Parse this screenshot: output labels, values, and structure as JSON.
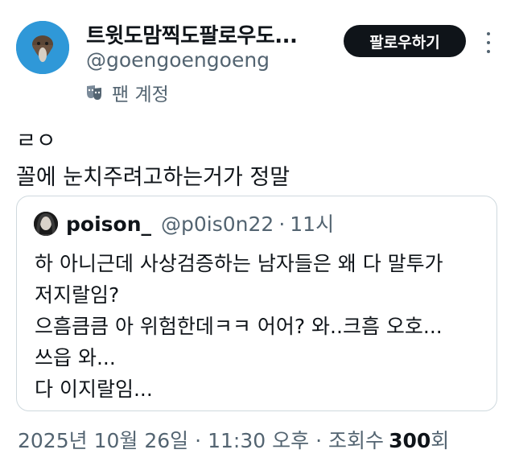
{
  "header": {
    "display_name": "트윗도맘찍도팔로우도...",
    "handle": "@goengoengoeng",
    "badge_label": "팬 계정",
    "follow_label": "팔로우하기"
  },
  "tweet": {
    "lines": [
      "ㄹㅇ",
      "꼴에 눈치주려고하는거가 정말"
    ]
  },
  "quote": {
    "name": "poison_",
    "handle": "@p0is0n22",
    "separator": "·",
    "time": "11시",
    "lines": [
      "하 아니근데 사상검증하는 남자들은 왜 다 말투가",
      "저지랄임?",
      "으흠큼큼 아 위험한데ㅋㅋ 어어? 와..크흠 오호...",
      "쓰읍 와...",
      "다 이지랄임..."
    ]
  },
  "meta": {
    "date": "2025년 10월 26일",
    "separator": "·",
    "time": "11:30 오후",
    "views_label": "조회수",
    "views_count": "300",
    "views_suffix": "회"
  },
  "colors": {
    "text": "#0f1419",
    "secondary": "#536471",
    "avatar_bg": "#2f98d8",
    "button_bg": "#0f1419",
    "card_border": "#cfd9de"
  }
}
